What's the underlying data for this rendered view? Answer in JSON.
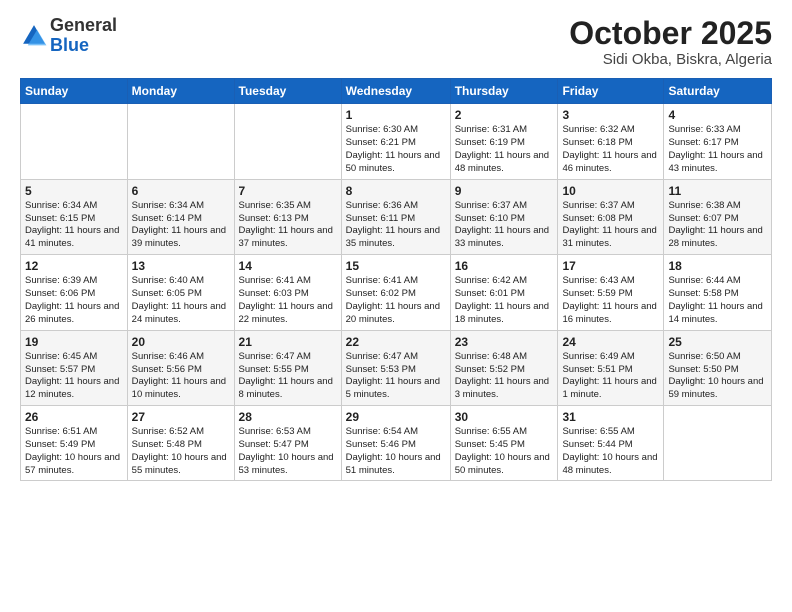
{
  "header": {
    "logo_general": "General",
    "logo_blue": "Blue",
    "month": "October 2025",
    "location": "Sidi Okba, Biskra, Algeria"
  },
  "days_of_week": [
    "Sunday",
    "Monday",
    "Tuesday",
    "Wednesday",
    "Thursday",
    "Friday",
    "Saturday"
  ],
  "weeks": [
    [
      {
        "day": "",
        "content": ""
      },
      {
        "day": "",
        "content": ""
      },
      {
        "day": "",
        "content": ""
      },
      {
        "day": "1",
        "content": "Sunrise: 6:30 AM\nSunset: 6:21 PM\nDaylight: 11 hours and 50 minutes."
      },
      {
        "day": "2",
        "content": "Sunrise: 6:31 AM\nSunset: 6:19 PM\nDaylight: 11 hours and 48 minutes."
      },
      {
        "day": "3",
        "content": "Sunrise: 6:32 AM\nSunset: 6:18 PM\nDaylight: 11 hours and 46 minutes."
      },
      {
        "day": "4",
        "content": "Sunrise: 6:33 AM\nSunset: 6:17 PM\nDaylight: 11 hours and 43 minutes."
      }
    ],
    [
      {
        "day": "5",
        "content": "Sunrise: 6:34 AM\nSunset: 6:15 PM\nDaylight: 11 hours and 41 minutes."
      },
      {
        "day": "6",
        "content": "Sunrise: 6:34 AM\nSunset: 6:14 PM\nDaylight: 11 hours and 39 minutes."
      },
      {
        "day": "7",
        "content": "Sunrise: 6:35 AM\nSunset: 6:13 PM\nDaylight: 11 hours and 37 minutes."
      },
      {
        "day": "8",
        "content": "Sunrise: 6:36 AM\nSunset: 6:11 PM\nDaylight: 11 hours and 35 minutes."
      },
      {
        "day": "9",
        "content": "Sunrise: 6:37 AM\nSunset: 6:10 PM\nDaylight: 11 hours and 33 minutes."
      },
      {
        "day": "10",
        "content": "Sunrise: 6:37 AM\nSunset: 6:08 PM\nDaylight: 11 hours and 31 minutes."
      },
      {
        "day": "11",
        "content": "Sunrise: 6:38 AM\nSunset: 6:07 PM\nDaylight: 11 hours and 28 minutes."
      }
    ],
    [
      {
        "day": "12",
        "content": "Sunrise: 6:39 AM\nSunset: 6:06 PM\nDaylight: 11 hours and 26 minutes."
      },
      {
        "day": "13",
        "content": "Sunrise: 6:40 AM\nSunset: 6:05 PM\nDaylight: 11 hours and 24 minutes."
      },
      {
        "day": "14",
        "content": "Sunrise: 6:41 AM\nSunset: 6:03 PM\nDaylight: 11 hours and 22 minutes."
      },
      {
        "day": "15",
        "content": "Sunrise: 6:41 AM\nSunset: 6:02 PM\nDaylight: 11 hours and 20 minutes."
      },
      {
        "day": "16",
        "content": "Sunrise: 6:42 AM\nSunset: 6:01 PM\nDaylight: 11 hours and 18 minutes."
      },
      {
        "day": "17",
        "content": "Sunrise: 6:43 AM\nSunset: 5:59 PM\nDaylight: 11 hours and 16 minutes."
      },
      {
        "day": "18",
        "content": "Sunrise: 6:44 AM\nSunset: 5:58 PM\nDaylight: 11 hours and 14 minutes."
      }
    ],
    [
      {
        "day": "19",
        "content": "Sunrise: 6:45 AM\nSunset: 5:57 PM\nDaylight: 11 hours and 12 minutes."
      },
      {
        "day": "20",
        "content": "Sunrise: 6:46 AM\nSunset: 5:56 PM\nDaylight: 11 hours and 10 minutes."
      },
      {
        "day": "21",
        "content": "Sunrise: 6:47 AM\nSunset: 5:55 PM\nDaylight: 11 hours and 8 minutes."
      },
      {
        "day": "22",
        "content": "Sunrise: 6:47 AM\nSunset: 5:53 PM\nDaylight: 11 hours and 5 minutes."
      },
      {
        "day": "23",
        "content": "Sunrise: 6:48 AM\nSunset: 5:52 PM\nDaylight: 11 hours and 3 minutes."
      },
      {
        "day": "24",
        "content": "Sunrise: 6:49 AM\nSunset: 5:51 PM\nDaylight: 11 hours and 1 minute."
      },
      {
        "day": "25",
        "content": "Sunrise: 6:50 AM\nSunset: 5:50 PM\nDaylight: 10 hours and 59 minutes."
      }
    ],
    [
      {
        "day": "26",
        "content": "Sunrise: 6:51 AM\nSunset: 5:49 PM\nDaylight: 10 hours and 57 minutes."
      },
      {
        "day": "27",
        "content": "Sunrise: 6:52 AM\nSunset: 5:48 PM\nDaylight: 10 hours and 55 minutes."
      },
      {
        "day": "28",
        "content": "Sunrise: 6:53 AM\nSunset: 5:47 PM\nDaylight: 10 hours and 53 minutes."
      },
      {
        "day": "29",
        "content": "Sunrise: 6:54 AM\nSunset: 5:46 PM\nDaylight: 10 hours and 51 minutes."
      },
      {
        "day": "30",
        "content": "Sunrise: 6:55 AM\nSunset: 5:45 PM\nDaylight: 10 hours and 50 minutes."
      },
      {
        "day": "31",
        "content": "Sunrise: 6:55 AM\nSunset: 5:44 PM\nDaylight: 10 hours and 48 minutes."
      },
      {
        "day": "",
        "content": ""
      }
    ]
  ]
}
